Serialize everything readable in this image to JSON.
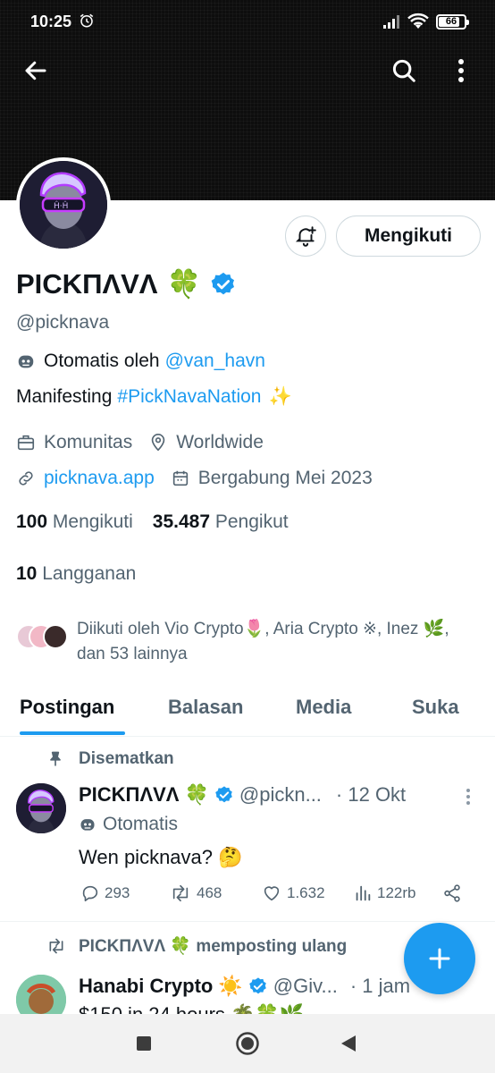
{
  "status_bar": {
    "time": "10:25",
    "battery": "66"
  },
  "profile": {
    "display_name": "PICKΠΛVΛ",
    "handle": "@picknava",
    "automated_label": "Otomatis oleh",
    "automated_by": "@van_havn",
    "bio_text": "Manifesting",
    "bio_hashtag": "#PickNavaNation",
    "category": "Komunitas",
    "location": "Worldwide",
    "website": "picknava.app",
    "joined": "Bergabung Mei 2023",
    "following_count": "100",
    "following_label": "Mengikuti",
    "followers_count": "35.487",
    "followers_label": "Pengikut",
    "subs_count": "10",
    "subs_label": "Langganan",
    "followed_by": "Diikuti oleh Vio Crypto🌷, Aria Crypto ※, Inez 🌿, dan 53 lainnya",
    "follow_button": "Mengikuti"
  },
  "tabs": [
    "Postingan",
    "Balasan",
    "Media",
    "Suka"
  ],
  "pinned_post": {
    "pinned_label": "Disematkan",
    "author": "PICKΠΛVΛ",
    "handle": "@pickn...",
    "time": "· 12 Okt",
    "automated": "Otomatis",
    "text": "Wen picknava? 🤔",
    "replies": "293",
    "reposts": "468",
    "likes": "1.632",
    "views": "122rb"
  },
  "repost": {
    "label": "PICKΠΛVΛ 🍀 memposting ulang",
    "author": "Hanabi Crypto",
    "handle": "@Giv...",
    "time": "· 1 jam",
    "text": "$150 in 24 hours 🌴🍀🌿"
  },
  "colors": {
    "accent": "#1d9bf0",
    "text": "#0f1419",
    "muted": "#536471"
  }
}
